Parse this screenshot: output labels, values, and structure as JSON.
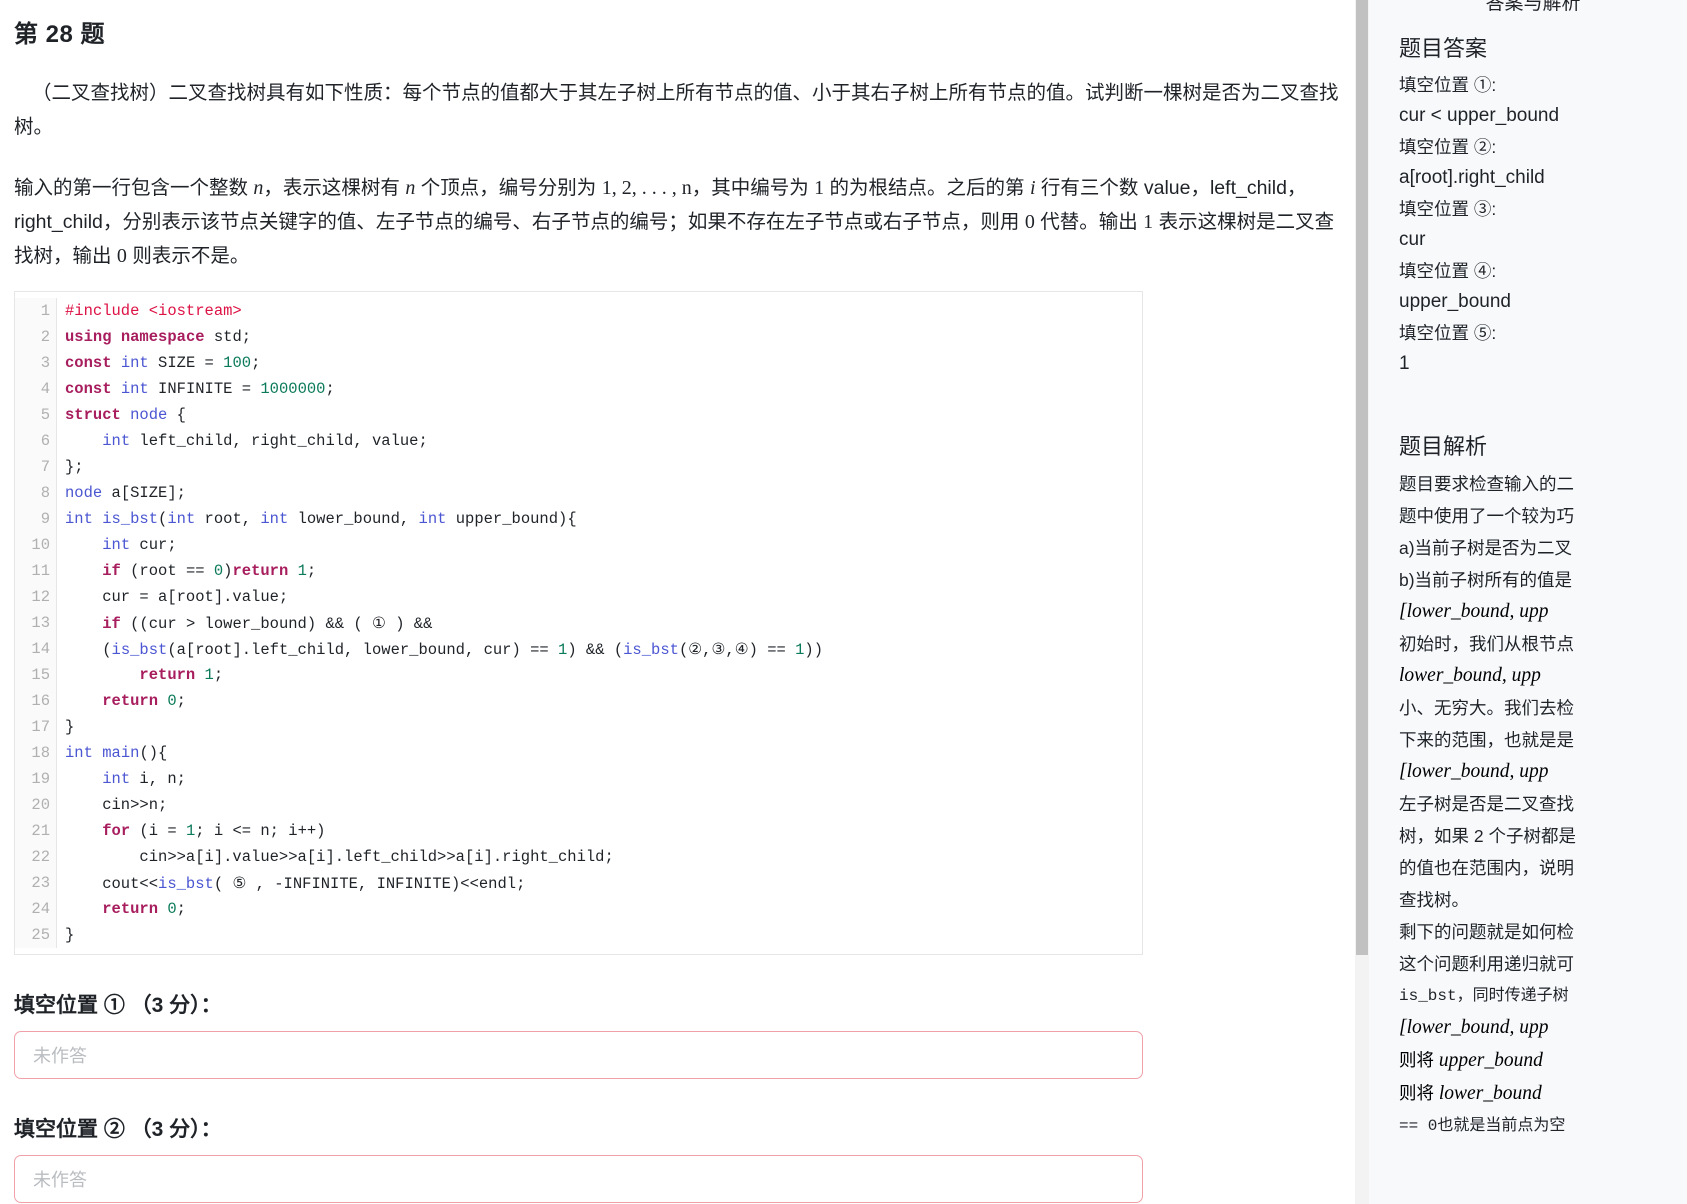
{
  "question": {
    "title": "第 28 题",
    "paragraph1_parts": [
      "（二叉查找树）二叉查找树具有如下性质：每个节点的值都大于其左子树上所有节点的值、小于其右子树上所有节点的值。试判断一棵树是否为二叉查找树。"
    ],
    "paragraph2_a": "输入的第一行包含一个整数 ",
    "paragraph2_n1": "n",
    "paragraph2_b": "，表示这棵树有 ",
    "paragraph2_n2": "n",
    "paragraph2_c": " 个顶点，编号分别为 ",
    "paragraph2_seq": "1, 2, . . . , n",
    "paragraph2_d": "，其中编号为 ",
    "paragraph2_one": "1",
    "paragraph2_e": " 的为根结点。之后的第 ",
    "paragraph2_i": "i",
    "paragraph2_f": " 行有三个数 value，left_child，right_child，分别表示该节点关键字的值、左子节点的编号、右子节点的编号；如果不存在左子节点或右子节点，则用 ",
    "paragraph2_zero": "0",
    "paragraph2_g": " 代替。输出 ",
    "paragraph2_one2": "1",
    "paragraph2_h": " 表示这棵树是二叉查找树，输出 ",
    "paragraph2_zero2": "0",
    "paragraph2_i2": " 则表示不是。"
  },
  "code": {
    "line_numbers": [
      "1",
      "2",
      "3",
      "4",
      "5",
      "6",
      "7",
      "8",
      "9",
      "10",
      "11",
      "12",
      "13",
      "14",
      "15",
      "16",
      "17",
      "18",
      "19",
      "20",
      "21",
      "22",
      "23",
      "24",
      "25"
    ],
    "lines": [
      "#include <iostream>",
      "using namespace std;",
      "const int SIZE = 100;",
      "const int INFINITE = 1000000;",
      "struct node {",
      "    int left_child, right_child, value;",
      "};",
      "node a[SIZE];",
      "int is_bst(int root, int lower_bound, int upper_bound){",
      "    int cur;",
      "    if (root == 0)return 1;",
      "    cur = a[root].value;",
      "    if ((cur > lower_bound) && ( ① ) &&",
      "    (is_bst(a[root].left_child, lower_bound, cur) == 1) && (is_bst(②,③,④) == 1))",
      "        return 1;",
      "    return 0;",
      "}",
      "int main(){",
      "    int i, n;",
      "    cin>>n;",
      "    for (i = 1; i <= n; i++)",
      "        cin>>a[i].value>>a[i].left_child>>a[i].right_child;",
      "    cout<<is_bst( ⑤ , -INFINITE, INFINITE)<<endl;",
      "    return 0;",
      "}"
    ],
    "colors": {
      "preprocessor": "#d14",
      "keyword": "#a71d5d",
      "type": "#4b56d2",
      "number": "#0b7a5a",
      "text": "#1f2328",
      "gutter": "#b0b0b0"
    }
  },
  "blanks": [
    {
      "label": "填空位置 ① （3 分）：",
      "placeholder": "未作答",
      "value": ""
    },
    {
      "label": "填空位置 ② （3 分）：",
      "placeholder": "未作答",
      "value": ""
    }
  ],
  "sidebar": {
    "panel_title": "答案与解析",
    "answers_heading": "题目答案",
    "answers": [
      {
        "label": "填空位置 ①:",
        "value": "cur < upper_bound"
      },
      {
        "label": "填空位置 ②:",
        "value": "a[root].right_child"
      },
      {
        "label": "填空位置 ③:",
        "value": "cur"
      },
      {
        "label": "填空位置 ④:",
        "value": "upper_bound"
      },
      {
        "label": "填空位置 ⑤:",
        "value": "1"
      }
    ],
    "analysis_heading": "题目解析",
    "analysis_lines": [
      {
        "style": "text",
        "text": "题目要求检查输入的二"
      },
      {
        "style": "text",
        "text": "题中使用了一个较为巧"
      },
      {
        "style": "text",
        "text": "a)当前子树是否为二叉"
      },
      {
        "style": "text",
        "text": "b)当前子树所有的值是"
      },
      {
        "style": "math",
        "text": "[lower_bound, upp"
      },
      {
        "style": "text",
        "text": "初始时，我们从根节点"
      },
      {
        "style": "math",
        "text": "lower_bound, upp"
      },
      {
        "style": "text",
        "text": "小、无穷大。我们去检"
      },
      {
        "style": "text",
        "text": "下来的范围，也就是是"
      },
      {
        "style": "math",
        "text": "[lower_bound, upp"
      },
      {
        "style": "text",
        "text": "左子树是否是二叉查找"
      },
      {
        "style": "text",
        "text": "树，如果 2 个子树都是"
      },
      {
        "style": "text",
        "text": "的值也在范围内，说明"
      },
      {
        "style": "text",
        "text": "查找树。"
      },
      {
        "style": "text",
        "text": "剩下的问题就是如何检"
      },
      {
        "style": "text",
        "text": "这个问题利用递归就可"
      },
      {
        "style": "mono",
        "text": "is_bst，同时传递子树"
      },
      {
        "style": "math",
        "text": "[lower_bound, upp"
      },
      {
        "style": "mix",
        "prefix": "则将 ",
        "math": "upper_bound",
        "suffix": ""
      },
      {
        "style": "mix",
        "prefix": "则将 ",
        "math": "lower_bound",
        "suffix": ""
      },
      {
        "style": "mono",
        "text": "== 0也就是当前点为空"
      }
    ],
    "scrollbar": {
      "thumb_height": 955
    },
    "background": "#f7f9fb"
  }
}
